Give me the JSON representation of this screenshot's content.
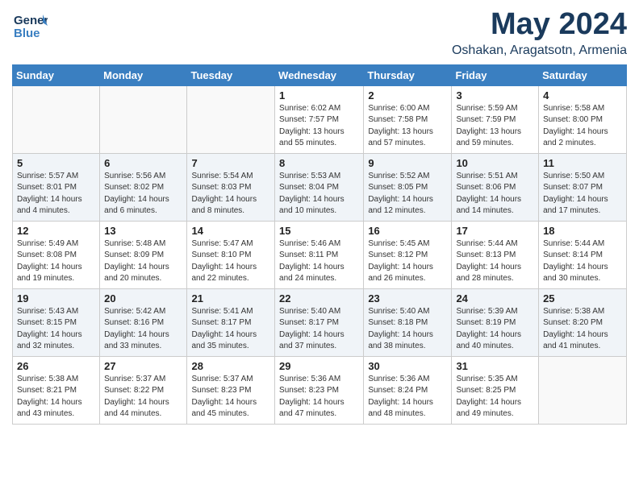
{
  "header": {
    "logo_line1": "General",
    "logo_line2": "Blue",
    "month": "May 2024",
    "location": "Oshakan, Aragatsotn, Armenia"
  },
  "weekdays": [
    "Sunday",
    "Monday",
    "Tuesday",
    "Wednesday",
    "Thursday",
    "Friday",
    "Saturday"
  ],
  "weeks": [
    [
      {
        "day": "",
        "info": ""
      },
      {
        "day": "",
        "info": ""
      },
      {
        "day": "",
        "info": ""
      },
      {
        "day": "1",
        "info": "Sunrise: 6:02 AM\nSunset: 7:57 PM\nDaylight: 13 hours\nand 55 minutes."
      },
      {
        "day": "2",
        "info": "Sunrise: 6:00 AM\nSunset: 7:58 PM\nDaylight: 13 hours\nand 57 minutes."
      },
      {
        "day": "3",
        "info": "Sunrise: 5:59 AM\nSunset: 7:59 PM\nDaylight: 13 hours\nand 59 minutes."
      },
      {
        "day": "4",
        "info": "Sunrise: 5:58 AM\nSunset: 8:00 PM\nDaylight: 14 hours\nand 2 minutes."
      }
    ],
    [
      {
        "day": "5",
        "info": "Sunrise: 5:57 AM\nSunset: 8:01 PM\nDaylight: 14 hours\nand 4 minutes."
      },
      {
        "day": "6",
        "info": "Sunrise: 5:56 AM\nSunset: 8:02 PM\nDaylight: 14 hours\nand 6 minutes."
      },
      {
        "day": "7",
        "info": "Sunrise: 5:54 AM\nSunset: 8:03 PM\nDaylight: 14 hours\nand 8 minutes."
      },
      {
        "day": "8",
        "info": "Sunrise: 5:53 AM\nSunset: 8:04 PM\nDaylight: 14 hours\nand 10 minutes."
      },
      {
        "day": "9",
        "info": "Sunrise: 5:52 AM\nSunset: 8:05 PM\nDaylight: 14 hours\nand 12 minutes."
      },
      {
        "day": "10",
        "info": "Sunrise: 5:51 AM\nSunset: 8:06 PM\nDaylight: 14 hours\nand 14 minutes."
      },
      {
        "day": "11",
        "info": "Sunrise: 5:50 AM\nSunset: 8:07 PM\nDaylight: 14 hours\nand 17 minutes."
      }
    ],
    [
      {
        "day": "12",
        "info": "Sunrise: 5:49 AM\nSunset: 8:08 PM\nDaylight: 14 hours\nand 19 minutes."
      },
      {
        "day": "13",
        "info": "Sunrise: 5:48 AM\nSunset: 8:09 PM\nDaylight: 14 hours\nand 20 minutes."
      },
      {
        "day": "14",
        "info": "Sunrise: 5:47 AM\nSunset: 8:10 PM\nDaylight: 14 hours\nand 22 minutes."
      },
      {
        "day": "15",
        "info": "Sunrise: 5:46 AM\nSunset: 8:11 PM\nDaylight: 14 hours\nand 24 minutes."
      },
      {
        "day": "16",
        "info": "Sunrise: 5:45 AM\nSunset: 8:12 PM\nDaylight: 14 hours\nand 26 minutes."
      },
      {
        "day": "17",
        "info": "Sunrise: 5:44 AM\nSunset: 8:13 PM\nDaylight: 14 hours\nand 28 minutes."
      },
      {
        "day": "18",
        "info": "Sunrise: 5:44 AM\nSunset: 8:14 PM\nDaylight: 14 hours\nand 30 minutes."
      }
    ],
    [
      {
        "day": "19",
        "info": "Sunrise: 5:43 AM\nSunset: 8:15 PM\nDaylight: 14 hours\nand 32 minutes."
      },
      {
        "day": "20",
        "info": "Sunrise: 5:42 AM\nSunset: 8:16 PM\nDaylight: 14 hours\nand 33 minutes."
      },
      {
        "day": "21",
        "info": "Sunrise: 5:41 AM\nSunset: 8:17 PM\nDaylight: 14 hours\nand 35 minutes."
      },
      {
        "day": "22",
        "info": "Sunrise: 5:40 AM\nSunset: 8:17 PM\nDaylight: 14 hours\nand 37 minutes."
      },
      {
        "day": "23",
        "info": "Sunrise: 5:40 AM\nSunset: 8:18 PM\nDaylight: 14 hours\nand 38 minutes."
      },
      {
        "day": "24",
        "info": "Sunrise: 5:39 AM\nSunset: 8:19 PM\nDaylight: 14 hours\nand 40 minutes."
      },
      {
        "day": "25",
        "info": "Sunrise: 5:38 AM\nSunset: 8:20 PM\nDaylight: 14 hours\nand 41 minutes."
      }
    ],
    [
      {
        "day": "26",
        "info": "Sunrise: 5:38 AM\nSunset: 8:21 PM\nDaylight: 14 hours\nand 43 minutes."
      },
      {
        "day": "27",
        "info": "Sunrise: 5:37 AM\nSunset: 8:22 PM\nDaylight: 14 hours\nand 44 minutes."
      },
      {
        "day": "28",
        "info": "Sunrise: 5:37 AM\nSunset: 8:23 PM\nDaylight: 14 hours\nand 45 minutes."
      },
      {
        "day": "29",
        "info": "Sunrise: 5:36 AM\nSunset: 8:23 PM\nDaylight: 14 hours\nand 47 minutes."
      },
      {
        "day": "30",
        "info": "Sunrise: 5:36 AM\nSunset: 8:24 PM\nDaylight: 14 hours\nand 48 minutes."
      },
      {
        "day": "31",
        "info": "Sunrise: 5:35 AM\nSunset: 8:25 PM\nDaylight: 14 hours\nand 49 minutes."
      },
      {
        "day": "",
        "info": ""
      }
    ]
  ]
}
